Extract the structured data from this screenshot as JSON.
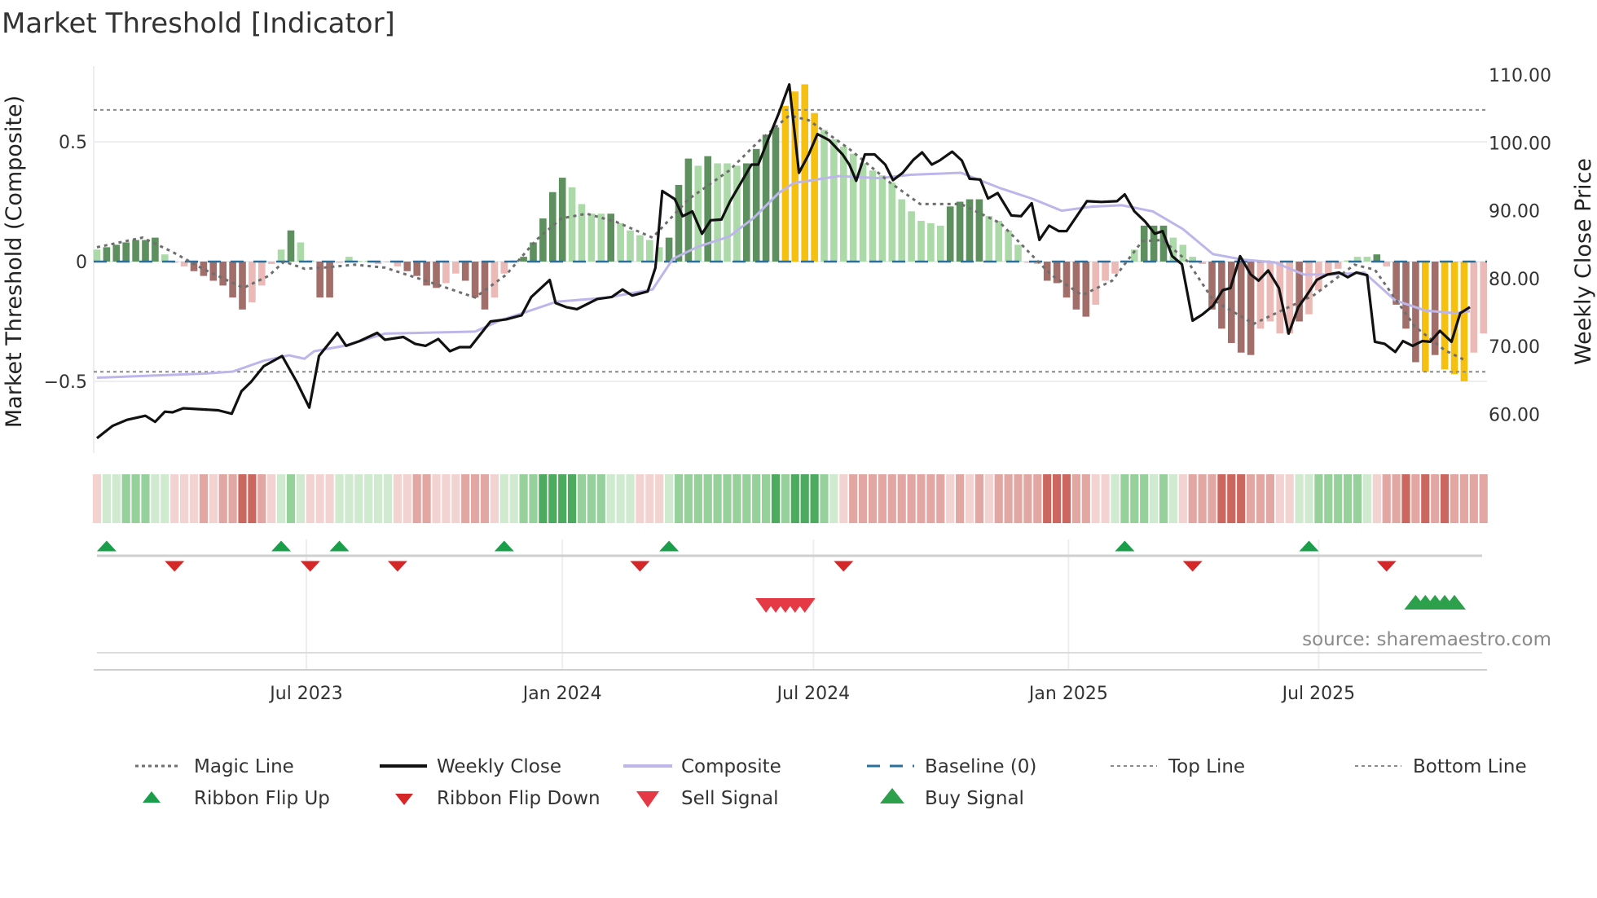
{
  "title": "Market Threshold [Indicator]",
  "source": "source: sharemaestro.com",
  "colors": {
    "bar_dark_green": "#5e8f5e",
    "bar_light_green": "#acd9a8",
    "bar_dark_red": "#a26e6a",
    "bar_light_red": "#ebbab6",
    "bar_yellow": "#f6c00f",
    "weekly_close": "#111111",
    "composite": "#bdb6ea",
    "magic_line": "#6e6e6e",
    "baseline": "#2b6f9c",
    "ribbon_green": [
      "#cfeacf",
      "#96d19c",
      "#4cab5e"
    ],
    "ribbon_red": [
      "#f3d3d2",
      "#e2a7a3",
      "#cc675f"
    ],
    "flip_up": "#1a9e4a",
    "flip_down": "#d62728",
    "sell": "#e63946",
    "buy": "#2ca04a"
  },
  "chart_data": {
    "type": "bar",
    "title": "Market Threshold [Indicator]",
    "xlabel": "",
    "ylabel_left": "Market Threshold (Composite)",
    "ylabel_right": "Weekly Close Price",
    "x_unit": "week index",
    "ylim_left": [
      -0.8,
      0.816
    ],
    "ylim_right": [
      54.3,
      111.3
    ],
    "left_ticks": [
      {
        "v": 0.5,
        "label": "0.5"
      },
      {
        "v": 0,
        "label": "0"
      },
      {
        "v": -0.5,
        "label": "−0.5"
      }
    ],
    "right_ticks": [
      {
        "v": 110,
        "label": "110.00"
      },
      {
        "v": 100,
        "label": "100.00"
      },
      {
        "v": 90,
        "label": "90.00"
      },
      {
        "v": 80,
        "label": "80.00"
      },
      {
        "v": 70,
        "label": "70.00"
      },
      {
        "v": 60,
        "label": "60.00"
      }
    ],
    "x_ticks": [
      {
        "week": 21.6,
        "label": "Jul 2023"
      },
      {
        "week": 48.0,
        "label": "Jan 2024"
      },
      {
        "week": 73.9,
        "label": "Jul 2024"
      },
      {
        "week": 100.2,
        "label": "Jan 2025"
      },
      {
        "week": 126.0,
        "label": "Jul 2025"
      }
    ],
    "top_line": 0.633,
    "bottom_line": -0.46,
    "baseline": 0,
    "composite_bars": {
      "values": [
        0.05,
        0.06,
        0.07,
        0.08,
        0.09,
        0.09,
        0.1,
        0.03,
        -0.005,
        -0.02,
        -0.04,
        -0.06,
        -0.08,
        -0.1,
        -0.15,
        -0.2,
        -0.17,
        -0.1,
        -0.01,
        0.05,
        0.13,
        0.08,
        0.005,
        -0.15,
        -0.15,
        -0.005,
        0.02,
        0.003,
        0.003,
        -0.01,
        -0.003,
        -0.02,
        -0.04,
        -0.06,
        -0.1,
        -0.11,
        -0.09,
        -0.05,
        -0.08,
        -0.15,
        -0.2,
        -0.15,
        -0.05,
        0.005,
        0.02,
        0.08,
        0.18,
        0.29,
        0.35,
        0.31,
        0.24,
        0.2,
        0.2,
        0.2,
        0.16,
        0.13,
        0.11,
        0.09,
        0.06,
        0.1,
        0.32,
        0.43,
        0.4,
        0.44,
        0.41,
        0.41,
        0.4,
        0.41,
        0.47,
        0.53,
        0.56,
        0.65,
        0.71,
        0.74,
        0.62,
        0.55,
        0.51,
        0.48,
        0.45,
        0.41,
        0.38,
        0.36,
        0.33,
        0.26,
        0.21,
        0.17,
        0.16,
        0.15,
        0.23,
        0.25,
        0.26,
        0.26,
        0.19,
        0.17,
        0.13,
        0.07,
        -0.005,
        -0.01,
        -0.08,
        -0.09,
        -0.15,
        -0.2,
        -0.23,
        -0.18,
        -0.08,
        -0.05,
        0.005,
        0.05,
        0.15,
        0.15,
        0.15,
        0.1,
        0.07,
        0.02,
        -0.01,
        -0.2,
        -0.28,
        -0.34,
        -0.38,
        -0.39,
        -0.28,
        -0.25,
        -0.3,
        -0.3,
        -0.25,
        -0.22,
        -0.12,
        -0.06,
        -0.03,
        0.005,
        0.02,
        0.02,
        0.03,
        -0.02,
        -0.18,
        -0.28,
        -0.42,
        -0.46,
        -0.39,
        -0.45,
        -0.47,
        -0.5,
        -0.38,
        -0.3
      ],
      "types": "gGGGGGGgrrRRRRRRrrrgGggRRrgggrrrRRRRrrRRRrrgGGGGGggggGgggggGGGgGgggGGGGYYYYgggggggggggggGGGGggggrrRRRRRrrrggGGGgggrRRRRRrrrrRrrrrgggGrRRRYRYYYrr",
      "type_legend": {
        "G": "strong positive",
        "g": "weak positive",
        "R": "strong negative",
        "r": "weak negative",
        "Y": "extreme"
      }
    },
    "weekly_close": [
      [
        0,
        56.5
      ],
      [
        1.6,
        58.3
      ],
      [
        3.1,
        59.2
      ],
      [
        5,
        59.8
      ],
      [
        6,
        58.9
      ],
      [
        7,
        60.4
      ],
      [
        7.8,
        60.3
      ],
      [
        8.9,
        60.9
      ],
      [
        12.5,
        60.6
      ],
      [
        13.9,
        60.1
      ],
      [
        14.9,
        63.4
      ],
      [
        15.9,
        64.8
      ],
      [
        17.2,
        67.1
      ],
      [
        19.1,
        68.6
      ],
      [
        20.6,
        64.8
      ],
      [
        21.9,
        61.0
      ],
      [
        22.9,
        68.6
      ],
      [
        24.8,
        72.0
      ],
      [
        25.7,
        70.1
      ],
      [
        27.1,
        70.8
      ],
      [
        28.9,
        72.0
      ],
      [
        29.7,
        71.0
      ],
      [
        31.6,
        71.4
      ],
      [
        32.8,
        70.4
      ],
      [
        33.9,
        70.1
      ],
      [
        35.2,
        71.1
      ],
      [
        36.4,
        69.3
      ],
      [
        37.4,
        69.9
      ],
      [
        38.5,
        69.9
      ],
      [
        40.6,
        73.7
      ],
      [
        42.2,
        74.0
      ],
      [
        43.8,
        74.6
      ],
      [
        44.8,
        77.3
      ],
      [
        46.7,
        79.8
      ],
      [
        47.3,
        76.4
      ],
      [
        48.4,
        75.8
      ],
      [
        49.5,
        75.5
      ],
      [
        51.6,
        77.0
      ],
      [
        53.1,
        77.3
      ],
      [
        54.2,
        78.4
      ],
      [
        55.2,
        77.5
      ],
      [
        56.8,
        78.1
      ],
      [
        57.6,
        81.6
      ],
      [
        58.3,
        92.9
      ],
      [
        59.6,
        91.7
      ],
      [
        60.4,
        89.2
      ],
      [
        61.4,
        89.9
      ],
      [
        62.4,
        86.6
      ],
      [
        63.3,
        88.6
      ],
      [
        64.4,
        88.7
      ],
      [
        65.3,
        91.4
      ],
      [
        66.7,
        94.8
      ],
      [
        67.5,
        96.8
      ],
      [
        68.2,
        96.8
      ],
      [
        69.3,
        100.8
      ],
      [
        70.3,
        104.3
      ],
      [
        71.4,
        108.6
      ],
      [
        72.4,
        95.6
      ],
      [
        73.4,
        98.3
      ],
      [
        74.3,
        101.3
      ],
      [
        75.5,
        100.4
      ],
      [
        76.9,
        98.3
      ],
      [
        77.6,
        96.8
      ],
      [
        78.3,
        94.4
      ],
      [
        79.2,
        98.3
      ],
      [
        80.2,
        98.3
      ],
      [
        81.3,
        96.8
      ],
      [
        82.1,
        94.5
      ],
      [
        83.1,
        95.6
      ],
      [
        84.2,
        97.5
      ],
      [
        85.1,
        98.6
      ],
      [
        86.1,
        96.8
      ],
      [
        86.9,
        97.4
      ],
      [
        88.2,
        98.7
      ],
      [
        89.2,
        97.4
      ],
      [
        90.0,
        94.7
      ],
      [
        91.1,
        94.6
      ],
      [
        91.9,
        91.8
      ],
      [
        92.9,
        92.6
      ],
      [
        94.3,
        89.3
      ],
      [
        95.3,
        89.2
      ],
      [
        96.4,
        91.1
      ],
      [
        97.2,
        85.7
      ],
      [
        98.2,
        87.8
      ],
      [
        99.2,
        87.0
      ],
      [
        100.0,
        87.0
      ],
      [
        101.0,
        89.1
      ],
      [
        102.1,
        91.4
      ],
      [
        103.6,
        91.3
      ],
      [
        105.2,
        91.4
      ],
      [
        106.0,
        92.4
      ],
      [
        107.0,
        89.9
      ],
      [
        108.1,
        88.4
      ],
      [
        109.1,
        86.6
      ],
      [
        109.9,
        87.0
      ],
      [
        110.9,
        83.3
      ],
      [
        111.9,
        82.1
      ],
      [
        113.0,
        73.8
      ],
      [
        114.0,
        74.7
      ],
      [
        115.1,
        76.0
      ],
      [
        116.1,
        78.3
      ],
      [
        116.9,
        78.6
      ],
      [
        117.9,
        83.3
      ],
      [
        119.0,
        80.6
      ],
      [
        119.8,
        79.7
      ],
      [
        120.8,
        81.2
      ],
      [
        121.9,
        78.6
      ],
      [
        122.9,
        71.9
      ],
      [
        123.9,
        75.8
      ],
      [
        124.8,
        77.6
      ],
      [
        125.8,
        79.8
      ],
      [
        126.9,
        80.6
      ],
      [
        128.1,
        80.9
      ],
      [
        129.0,
        80.2
      ],
      [
        129.9,
        80.9
      ],
      [
        131.0,
        80.5
      ],
      [
        131.8,
        70.7
      ],
      [
        132.8,
        70.4
      ],
      [
        133.9,
        69.2
      ],
      [
        134.7,
        70.8
      ],
      [
        135.7,
        70.1
      ],
      [
        136.7,
        70.8
      ],
      [
        137.5,
        70.7
      ],
      [
        138.5,
        72.3
      ],
      [
        139.7,
        70.7
      ],
      [
        140.6,
        74.9
      ],
      [
        141.6,
        75.8
      ]
    ],
    "composite": [
      [
        0,
        65.4
      ],
      [
        11,
        66.0
      ],
      [
        14,
        66.3
      ],
      [
        17.2,
        67.9
      ],
      [
        19.8,
        68.7
      ],
      [
        21.4,
        68.2
      ],
      [
        22.4,
        69.3
      ],
      [
        25.5,
        70.1
      ],
      [
        29.7,
        71.9
      ],
      [
        39,
        72.2
      ],
      [
        41.7,
        73.9
      ],
      [
        44.3,
        75.1
      ],
      [
        47.4,
        76.6
      ],
      [
        52.6,
        77.2
      ],
      [
        57.3,
        78.4
      ],
      [
        59.4,
        82.9
      ],
      [
        62,
        84.7
      ],
      [
        65.2,
        86.2
      ],
      [
        67.7,
        88.9
      ],
      [
        70.3,
        92.6
      ],
      [
        71.9,
        94.1
      ],
      [
        73.4,
        94.4
      ],
      [
        76.5,
        95.1
      ],
      [
        80.7,
        94.8
      ],
      [
        83.9,
        95.3
      ],
      [
        89.1,
        95.6
      ],
      [
        93.2,
        93.3
      ],
      [
        96.4,
        91.8
      ],
      [
        99.5,
        90.0
      ],
      [
        102.6,
        90.6
      ],
      [
        105.7,
        90.8
      ],
      [
        108.9,
        89.9
      ],
      [
        112,
        87.3
      ],
      [
        115.1,
        83.6
      ],
      [
        118.2,
        82.8
      ],
      [
        121.4,
        82.4
      ],
      [
        124.5,
        80.6
      ],
      [
        127.6,
        80.6
      ],
      [
        130.7,
        80.9
      ],
      [
        133.9,
        76.8
      ],
      [
        137,
        75.3
      ],
      [
        140.1,
        74.9
      ],
      [
        141.6,
        75.2
      ]
    ],
    "magic_line": [
      [
        0,
        0.06
      ],
      [
        4.7,
        0.1
      ],
      [
        7.8,
        0.04
      ],
      [
        10.9,
        -0.03
      ],
      [
        15.1,
        -0.11
      ],
      [
        17.7,
        -0.06
      ],
      [
        19.3,
        0
      ],
      [
        21.4,
        -0.03
      ],
      [
        23.4,
        -0.025
      ],
      [
        26.6,
        -0.013
      ],
      [
        29.7,
        -0.025
      ],
      [
        33.9,
        -0.08
      ],
      [
        39,
        -0.15
      ],
      [
        42.2,
        -0.055
      ],
      [
        45.3,
        0.09
      ],
      [
        47.9,
        0.18
      ],
      [
        50.5,
        0.2
      ],
      [
        53.6,
        0.165
      ],
      [
        57.3,
        0.1
      ],
      [
        61,
        0.26
      ],
      [
        65.2,
        0.38
      ],
      [
        68.2,
        0.5
      ],
      [
        71.4,
        0.61
      ],
      [
        73.4,
        0.59
      ],
      [
        77.6,
        0.47
      ],
      [
        81.8,
        0.33
      ],
      [
        84.9,
        0.24
      ],
      [
        89.1,
        0.24
      ],
      [
        93.2,
        0.16
      ],
      [
        98.4,
        -0.055
      ],
      [
        101.6,
        -0.14
      ],
      [
        104.7,
        -0.08
      ],
      [
        107.8,
        0.085
      ],
      [
        109.9,
        0.09
      ],
      [
        112.5,
        0
      ],
      [
        115.1,
        -0.16
      ],
      [
        119.3,
        -0.26
      ],
      [
        122.4,
        -0.2
      ],
      [
        125.5,
        -0.14
      ],
      [
        129.7,
        -0.013
      ],
      [
        131.8,
        -0.034
      ],
      [
        135.9,
        -0.27
      ],
      [
        139,
        -0.37
      ],
      [
        141,
        -0.41
      ]
    ],
    "ribbon": [
      -1,
      1,
      1,
      2,
      2,
      2,
      1,
      1,
      -1,
      -1,
      -1,
      -2,
      -1,
      -2,
      -2,
      -3,
      -3,
      -2,
      -1,
      1,
      2,
      1,
      -1,
      -1,
      -1,
      1,
      1,
      1,
      1,
      1,
      1,
      -1,
      -1,
      -2,
      -2,
      -1,
      -1,
      -1,
      -2,
      -2,
      -2,
      -1,
      1,
      1,
      2,
      2,
      3,
      3,
      3,
      3,
      2,
      2,
      2,
      1,
      1,
      1,
      -1,
      -1,
      -1,
      1,
      2,
      2,
      2,
      2,
      2,
      2,
      2,
      2,
      2,
      2,
      3,
      2,
      3,
      3,
      3,
      2,
      1,
      -1,
      -2,
      -2,
      -2,
      -2,
      -2,
      -2,
      -2,
      -2,
      -2,
      -2,
      -1,
      -2,
      -1,
      -2,
      -1,
      -2,
      -2,
      -2,
      -2,
      -2,
      -3,
      -3,
      -3,
      -2,
      -2,
      -1,
      -1,
      1,
      2,
      2,
      2,
      1,
      2,
      1,
      -1,
      -2,
      -2,
      -2,
      -3,
      -3,
      -3,
      -2,
      -2,
      -2,
      -1,
      -1,
      1,
      1,
      2,
      2,
      2,
      2,
      2,
      1,
      -1,
      -2,
      -2,
      -3,
      -2,
      -3,
      -2,
      -3,
      -2,
      -2,
      -2,
      -2
    ],
    "ribbon_flip_up": [
      1,
      19,
      25,
      42,
      59,
      106,
      125
    ],
    "ribbon_flip_down": [
      8,
      22,
      31,
      56,
      77,
      113,
      133
    ],
    "sell_signal": [
      69,
      70,
      71,
      72,
      73
    ],
    "buy_signal": [
      136,
      137,
      138,
      139,
      140
    ],
    "legend": [
      {
        "label": "Magic Line"
      },
      {
        "label": "Weekly Close"
      },
      {
        "label": "Composite"
      },
      {
        "label": "Baseline (0)"
      },
      {
        "label": "Top Line"
      },
      {
        "label": "Bottom Line"
      },
      {
        "label": "Ribbon Flip Up"
      },
      {
        "label": "Ribbon Flip Down"
      },
      {
        "label": "Sell Signal"
      },
      {
        "label": "Buy Signal"
      }
    ],
    "legend_placement": "bottom"
  }
}
